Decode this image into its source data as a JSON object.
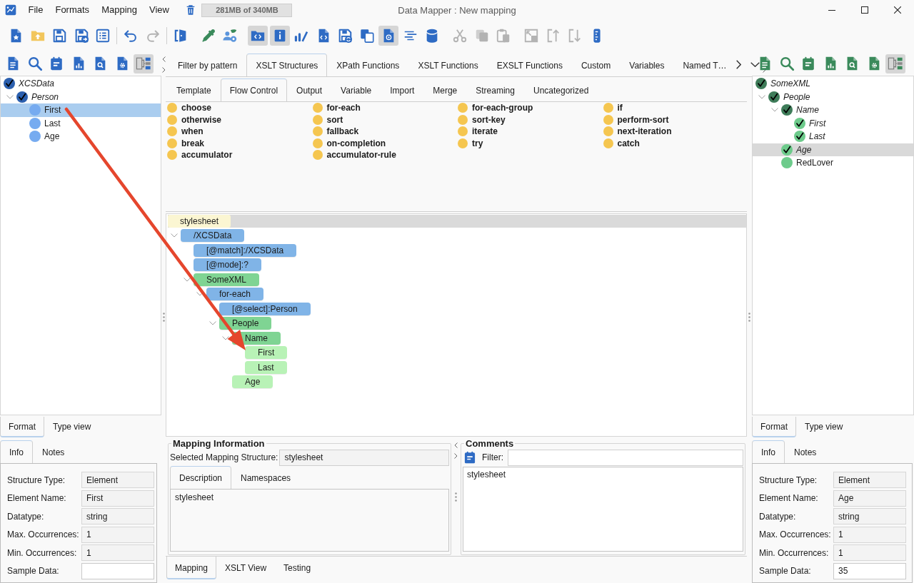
{
  "window": {
    "title": "Data Mapper : New mapping",
    "memory": "281MB of 340MB"
  },
  "menu": [
    "File",
    "Formats",
    "Mapping",
    "View"
  ],
  "toolbar": {
    "groups": [
      {
        "separator": false,
        "buttons": [
          {
            "on": false,
            "disabled": false
          },
          {
            "on": false,
            "disabled": false
          },
          {
            "on": false,
            "disabled": false
          },
          {
            "on": false,
            "disabled": false
          },
          {
            "on": false,
            "disabled": false
          }
        ]
      },
      {
        "separator": true,
        "buttons": [
          {
            "on": false,
            "disabled": false
          },
          {
            "on": false,
            "disabled": true
          }
        ]
      },
      {
        "separator": true,
        "buttons": [
          {
            "on": false,
            "disabled": false
          }
        ]
      },
      {
        "separator": false,
        "buttons": [
          {
            "on": false,
            "disabled": false
          },
          {
            "on": false,
            "disabled": false
          }
        ]
      },
      {
        "separator": false,
        "buttons": [
          {
            "on": true,
            "disabled": false
          },
          {
            "on": true,
            "disabled": false
          },
          {
            "on": false,
            "disabled": false
          },
          {
            "on": false,
            "disabled": false
          },
          {
            "on": false,
            "disabled": false
          },
          {
            "on": false,
            "disabled": false
          },
          {
            "on": true,
            "disabled": false
          },
          {
            "on": false,
            "disabled": false
          },
          {
            "on": false,
            "disabled": false
          }
        ]
      },
      {
        "separator": false,
        "buttons": [
          {
            "on": false,
            "disabled": true
          },
          {
            "on": false,
            "disabled": true
          },
          {
            "on": false,
            "disabled": true
          }
        ]
      },
      {
        "separator": false,
        "buttons": [
          {
            "on": false,
            "disabled": true
          },
          {
            "on": false,
            "disabled": true
          },
          {
            "on": false,
            "disabled": true
          },
          {
            "on": false,
            "disabled": false
          }
        ]
      }
    ]
  },
  "source_panel": {
    "kind": "source",
    "toolbar": [
      {
        "on": false
      },
      {
        "on": false
      },
      {
        "on": false
      },
      {
        "on": false
      },
      {
        "on": false
      },
      {
        "on": false
      },
      {
        "on": true
      }
    ],
    "tree": {
      "focused": true,
      "items": [
        {
          "label": "XCSData",
          "checked": true,
          "selected": false,
          "children": [
            {
              "label": "Person",
              "checked": true,
              "selected": false,
              "expanded": true,
              "children": [
                {
                  "label": "First",
                  "checked": false,
                  "selected": true
                },
                {
                  "label": "Last",
                  "checked": false,
                  "selected": false
                },
                {
                  "label": "Age",
                  "checked": false,
                  "selected": false
                }
              ]
            }
          ]
        }
      ]
    },
    "view_tabs": [
      {
        "label": "Format",
        "selected": true
      },
      {
        "label": "Type view",
        "selected": false
      }
    ],
    "info_tabs": [
      {
        "label": "Info",
        "selected": true
      },
      {
        "label": "Notes",
        "selected": false
      }
    ],
    "fields": [
      {
        "label": "Structure Type:",
        "value": "Element",
        "readonly": true
      },
      {
        "label": "Element Name:",
        "value": "First",
        "readonly": true
      },
      {
        "label": "Datatype:",
        "value": "string",
        "readonly": true
      },
      {
        "label": "Max. Occurrences:",
        "value": "1",
        "readonly": true
      },
      {
        "label": "Min. Occurrences:",
        "value": "1",
        "readonly": true
      },
      {
        "label": "Sample Data:",
        "readonly": false
      }
    ]
  },
  "palette": {
    "tabs": [
      {
        "label": "Filter by pattern",
        "selected": false
      },
      {
        "label": "XSLT Structures",
        "selected": true
      },
      {
        "label": "XPath Functions",
        "selected": false
      },
      {
        "label": "XSLT Functions",
        "selected": false
      },
      {
        "label": "EXSLT Functions",
        "selected": false
      },
      {
        "label": "Custom",
        "selected": false
      },
      {
        "label": "Variables",
        "selected": false
      },
      {
        "label": "Named T…",
        "selected": false
      }
    ],
    "subtabs": [
      {
        "label": "Template",
        "selected": false
      },
      {
        "label": "Flow Control",
        "selected": true
      },
      {
        "label": "Output",
        "selected": false
      },
      {
        "label": "Variable",
        "selected": false
      },
      {
        "label": "Import",
        "selected": false
      },
      {
        "label": "Merge",
        "selected": false
      },
      {
        "label": "Streaming",
        "selected": false
      },
      {
        "label": "Uncategorized",
        "selected": false
      }
    ],
    "items": [
      "choose",
      "for-each",
      "for-each-group",
      "if",
      "otherwise",
      "sort",
      "sort-key",
      "perform-sort",
      "when",
      "fallback",
      "iterate",
      "next-iteration",
      "break",
      "on-completion",
      "try",
      "catch",
      "accumulator",
      "accumulator-rule"
    ]
  },
  "mapping_tree": {
    "root": {
      "label": "stylesheet"
    },
    "items": [
      {
        "label": "/XCSData",
        "kind": "instruction",
        "expanded": true,
        "children": [
          {
            "label": "[@match]:/XCSData",
            "kind": "attribute"
          },
          {
            "label": "[@mode]:?",
            "kind": "attribute"
          },
          {
            "label": "SomeXML",
            "kind": "element",
            "expanded": true,
            "children": [
              {
                "label": "for-each",
                "kind": "instruction",
                "expanded": true,
                "children": [
                  {
                    "label": "[@select]:Person",
                    "kind": "attribute"
                  },
                  {
                    "label": "People",
                    "kind": "element",
                    "expanded": true,
                    "children": [
                      {
                        "label": "Name",
                        "kind": "element",
                        "expanded": true,
                        "children": [
                          {
                            "label": "First",
                            "kind": "element"
                          },
                          {
                            "label": "Last",
                            "kind": "element"
                          }
                        ]
                      },
                      {
                        "label": "Age",
                        "kind": "element"
                      }
                    ]
                  }
                ]
              }
            ]
          }
        ]
      }
    ]
  },
  "mapping_info": {
    "title": "Mapping Information",
    "structure_label": "Selected Mapping Structure:",
    "structure": "stylesheet",
    "tabs": [
      {
        "label": "Description",
        "selected": true
      },
      {
        "label": "Namespaces",
        "selected": false
      }
    ],
    "description": "stylesheet"
  },
  "comments": {
    "title": "Comments",
    "filter_label": "Filter:",
    "items": [
      "stylesheet"
    ]
  },
  "view_tabs": [
    {
      "label": "Mapping",
      "selected": true
    },
    {
      "label": "XSLT View",
      "selected": false
    },
    {
      "label": "Testing",
      "selected": false
    }
  ],
  "target_panel": {
    "kind": "target",
    "toolbar": [
      {
        "on": false
      },
      {
        "on": false
      },
      {
        "on": false
      },
      {
        "on": false
      },
      {
        "on": false
      },
      {
        "on": false
      },
      {
        "on": true
      }
    ],
    "tree": {
      "focused": false,
      "items": [
        {
          "label": "SomeXML",
          "checked": true,
          "selected": false,
          "children": [
            {
              "label": "People",
              "checked": true,
              "selected": false,
              "expanded": true,
              "children": [
                {
                  "label": "Name",
                  "checked": true,
                  "selected": false,
                  "expanded": true,
                  "children": [
                    {
                      "label": "First",
                      "checked": true,
                      "selected": false
                    },
                    {
                      "label": "Last",
                      "checked": true,
                      "selected": false
                    }
                  ]
                },
                {
                  "label": "Age",
                  "checked": true,
                  "selected": true
                },
                {
                  "label": "RedLover",
                  "checked": false,
                  "selected": false
                }
              ]
            }
          ]
        }
      ]
    },
    "view_tabs": [
      {
        "label": "Format",
        "selected": true
      },
      {
        "label": "Type view",
        "selected": false
      }
    ],
    "info_tabs": [
      {
        "label": "Info",
        "selected": true
      },
      {
        "label": "Notes",
        "selected": false
      }
    ],
    "fields": [
      {
        "label": "Structure Type:",
        "value": "Element",
        "readonly": true
      },
      {
        "label": "Element Name:",
        "value": "Age",
        "readonly": true
      },
      {
        "label": "Datatype:",
        "value": "string",
        "readonly": true
      },
      {
        "label": "Max. Occurrences:",
        "value": "1",
        "readonly": true
      },
      {
        "label": "Min. Occurrences:",
        "value": "1",
        "readonly": true
      },
      {
        "label": "Sample Data:",
        "value": "35",
        "readonly": false
      }
    ]
  }
}
